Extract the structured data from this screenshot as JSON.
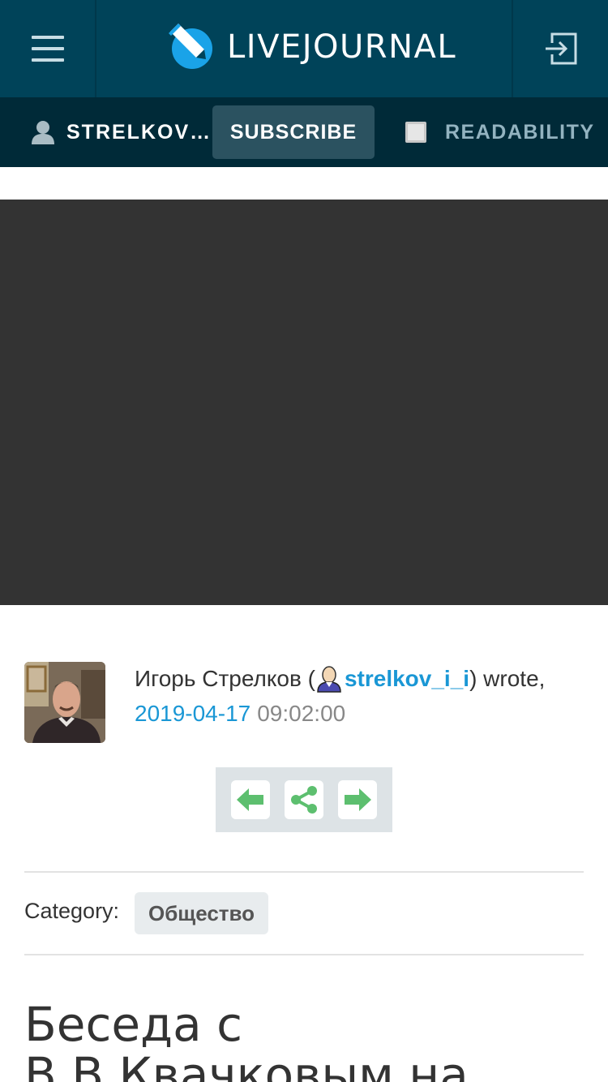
{
  "header": {
    "logo_text": "LIVEJOURNAL",
    "brand_color": "#004359",
    "accent_color": "#1a97d5"
  },
  "subbar": {
    "username": "STRELKOV_...",
    "subscribe_label": "SUBSCRIBE",
    "readability_label": "READABILITY",
    "readability_checked": false
  },
  "post": {
    "author_name": "Игорь Стрелков (",
    "author_username": "strelkov_i_i",
    "author_suffix": ") wrote,",
    "date": "2019-04-17",
    "time": "09:02:00",
    "category_label": "Category:",
    "category_tag": "Общество",
    "title": "Беседа с В.В.Квачковым на"
  },
  "nav": {
    "prev_icon": "arrow-left-icon",
    "share_icon": "share-icon",
    "next_icon": "arrow-right-icon",
    "icon_color": "#5dbf6f"
  }
}
